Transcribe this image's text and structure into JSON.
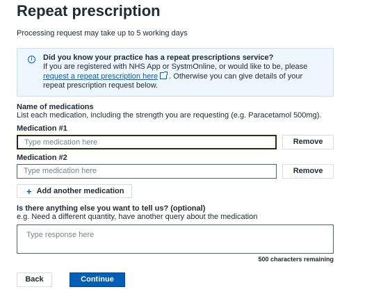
{
  "page": {
    "title": "Repeat prescription",
    "intro": "Processing request may take up to 5 working days"
  },
  "info": {
    "icon": "info-icon",
    "heading": "Did you know your practice has a repeat prescriptions service?",
    "text_before": "If you are registered with NHS App or SystmOnline, or would like to be, please",
    "link_text": "request a repeat prescription here",
    "text_after": ". Otherwise you can give details of your repeat prescription request below."
  },
  "medications": {
    "title": "Name of medications",
    "hint": "List each medication, including the strength you are requesting (e.g. Paracetamol 500mg).",
    "items": [
      {
        "label": "Medication #1",
        "placeholder": "Type medication here",
        "remove_label": "Remove"
      },
      {
        "label": "Medication #2",
        "placeholder": "Type medication here",
        "remove_label": "Remove"
      }
    ],
    "add_label": "Add another medication"
  },
  "extra": {
    "label": "Is there anything else you want to tell us? (optional)",
    "hint": "e.g. Need a different quantity, have another query about the medication",
    "placeholder": "Type response here",
    "counter": "500 characters remaining"
  },
  "actions": {
    "back_label": "Back",
    "continue_label": "Continue"
  },
  "colors": {
    "primary": "#005eb8",
    "text": "#212b32",
    "info_bg": "#eef7ff"
  }
}
